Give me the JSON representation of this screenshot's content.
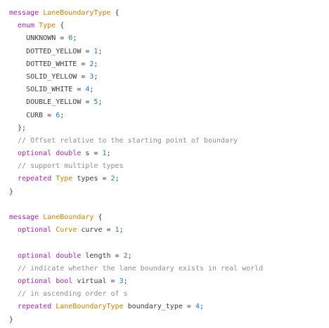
{
  "colors": {
    "keyword": "#a626a4",
    "type": "#c18401",
    "comment": "#8e8e8e",
    "number": "#1a7ad4",
    "plain": "#383a42",
    "background": "#ffffff"
  },
  "code": {
    "lines": [
      [
        {
          "t": "message",
          "c": "kw"
        },
        {
          "t": " ",
          "c": "pl"
        },
        {
          "t": "LaneBoundaryType",
          "c": "ty"
        },
        {
          "t": " {",
          "c": "pl"
        }
      ],
      [
        {
          "t": "  ",
          "c": "pl"
        },
        {
          "t": "enum",
          "c": "kw"
        },
        {
          "t": " ",
          "c": "pl"
        },
        {
          "t": "Type",
          "c": "ty"
        },
        {
          "t": " {",
          "c": "pl"
        }
      ],
      [
        {
          "t": "    UNKNOWN = ",
          "c": "pl"
        },
        {
          "t": "0",
          "c": "num"
        },
        {
          "t": ";",
          "c": "pl"
        }
      ],
      [
        {
          "t": "    DOTTED_YELLOW = ",
          "c": "pl"
        },
        {
          "t": "1",
          "c": "num"
        },
        {
          "t": ";",
          "c": "pl"
        }
      ],
      [
        {
          "t": "    DOTTED_WHITE = ",
          "c": "pl"
        },
        {
          "t": "2",
          "c": "num"
        },
        {
          "t": ";",
          "c": "pl"
        }
      ],
      [
        {
          "t": "    SOLID_YELLOW = ",
          "c": "pl"
        },
        {
          "t": "3",
          "c": "num"
        },
        {
          "t": ";",
          "c": "pl"
        }
      ],
      [
        {
          "t": "    SOLID_WHITE = ",
          "c": "pl"
        },
        {
          "t": "4",
          "c": "num"
        },
        {
          "t": ";",
          "c": "pl"
        }
      ],
      [
        {
          "t": "    DOUBLE_YELLOW = ",
          "c": "pl"
        },
        {
          "t": "5",
          "c": "num"
        },
        {
          "t": ";",
          "c": "pl"
        }
      ],
      [
        {
          "t": "    CURB = ",
          "c": "pl"
        },
        {
          "t": "6",
          "c": "num"
        },
        {
          "t": ";",
          "c": "pl"
        }
      ],
      [
        {
          "t": "  };",
          "c": "pl"
        }
      ],
      [
        {
          "t": "  // Offset relative to the starting point of boundary",
          "c": "cm"
        }
      ],
      [
        {
          "t": "  ",
          "c": "pl"
        },
        {
          "t": "optional",
          "c": "kw"
        },
        {
          "t": " ",
          "c": "pl"
        },
        {
          "t": "double",
          "c": "kw"
        },
        {
          "t": " s = ",
          "c": "pl"
        },
        {
          "t": "1",
          "c": "num"
        },
        {
          "t": ";",
          "c": "pl"
        }
      ],
      [
        {
          "t": "  // support multiple types",
          "c": "cm"
        }
      ],
      [
        {
          "t": "  ",
          "c": "pl"
        },
        {
          "t": "repeated",
          "c": "kw"
        },
        {
          "t": " ",
          "c": "pl"
        },
        {
          "t": "Type",
          "c": "ty"
        },
        {
          "t": " types = ",
          "c": "pl"
        },
        {
          "t": "2",
          "c": "num"
        },
        {
          "t": ";",
          "c": "pl"
        }
      ],
      [
        {
          "t": "}",
          "c": "pl"
        }
      ],
      [],
      [
        {
          "t": "message",
          "c": "kw"
        },
        {
          "t": " ",
          "c": "pl"
        },
        {
          "t": "LaneBoundary",
          "c": "ty"
        },
        {
          "t": " {",
          "c": "pl"
        }
      ],
      [
        {
          "t": "  ",
          "c": "pl"
        },
        {
          "t": "optional",
          "c": "kw"
        },
        {
          "t": " ",
          "c": "pl"
        },
        {
          "t": "Curve",
          "c": "ty"
        },
        {
          "t": " curve = ",
          "c": "pl"
        },
        {
          "t": "1",
          "c": "num"
        },
        {
          "t": ";",
          "c": "pl"
        }
      ],
      [],
      [
        {
          "t": "  ",
          "c": "pl"
        },
        {
          "t": "optional",
          "c": "kw"
        },
        {
          "t": " ",
          "c": "pl"
        },
        {
          "t": "double",
          "c": "kw"
        },
        {
          "t": " length = ",
          "c": "pl"
        },
        {
          "t": "2",
          "c": "num"
        },
        {
          "t": ";",
          "c": "pl"
        }
      ],
      [
        {
          "t": "  // indicate whether the lane boundary exists in real world",
          "c": "cm"
        }
      ],
      [
        {
          "t": "  ",
          "c": "pl"
        },
        {
          "t": "optional",
          "c": "kw"
        },
        {
          "t": " ",
          "c": "pl"
        },
        {
          "t": "bool",
          "c": "kw"
        },
        {
          "t": " virtual = ",
          "c": "pl"
        },
        {
          "t": "3",
          "c": "num"
        },
        {
          "t": ";",
          "c": "pl"
        }
      ],
      [
        {
          "t": "  // in ascending order of s",
          "c": "cm"
        }
      ],
      [
        {
          "t": "  ",
          "c": "pl"
        },
        {
          "t": "repeated",
          "c": "kw"
        },
        {
          "t": " ",
          "c": "pl"
        },
        {
          "t": "LaneBoundaryType",
          "c": "ty"
        },
        {
          "t": " boundary_type = ",
          "c": "pl"
        },
        {
          "t": "4",
          "c": "num"
        },
        {
          "t": ";",
          "c": "pl"
        }
      ],
      [
        {
          "t": "}",
          "c": "pl"
        }
      ]
    ]
  }
}
